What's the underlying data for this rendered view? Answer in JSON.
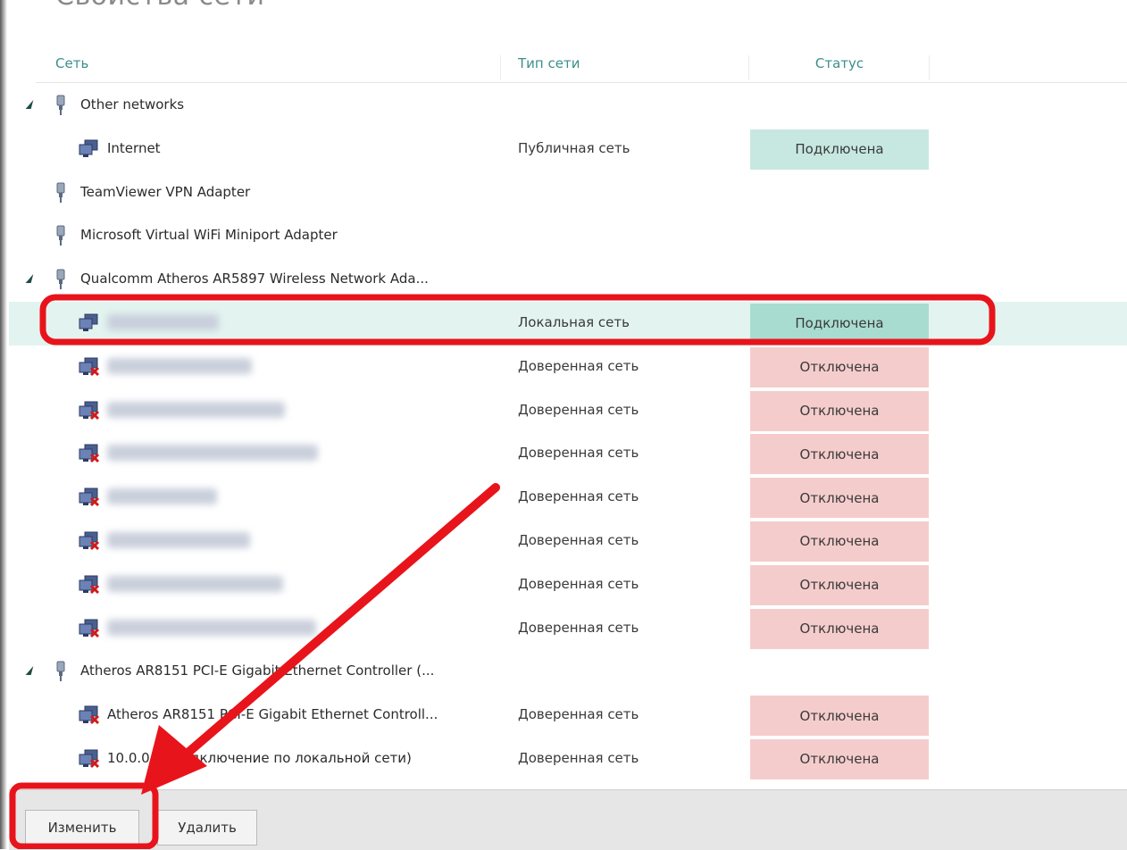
{
  "window": {
    "title": "Свойства сети"
  },
  "columns": {
    "network": "Сеть",
    "type": "Тип сети",
    "status": "Статус"
  },
  "rows": [
    {
      "kind": "adapter",
      "label": "Other networks",
      "expanded": true
    },
    {
      "kind": "network",
      "label": "Internet",
      "type": "Публичная сеть",
      "status": "Подключена"
    },
    {
      "kind": "adapter",
      "label": "TeamViewer VPN Adapter",
      "expanded": false
    },
    {
      "kind": "adapter",
      "label": "Microsoft Virtual WiFi Miniport Adapter",
      "expanded": false
    },
    {
      "kind": "adapter",
      "label": "Qualcomm Atheros AR5897 Wireless Network Ada...",
      "expanded": true
    },
    {
      "kind": "network",
      "label": "",
      "type": "Локальная сеть",
      "status": "Подключена",
      "selected": true
    },
    {
      "kind": "network-off",
      "label": "",
      "type": "Доверенная сеть",
      "status": "Отключена"
    },
    {
      "kind": "network-off",
      "label": "",
      "type": "Доверенная сеть",
      "status": "Отключена"
    },
    {
      "kind": "network-off",
      "label": "",
      "type": "Доверенная сеть",
      "status": "Отключена"
    },
    {
      "kind": "network-off",
      "label": "",
      "type": "Доверенная сеть",
      "status": "Отключена"
    },
    {
      "kind": "network-off",
      "label": "",
      "type": "Доверенная сеть",
      "status": "Отключена"
    },
    {
      "kind": "network-off",
      "label": "",
      "type": "Доверенная сеть",
      "status": "Отключена"
    },
    {
      "kind": "network-off",
      "label": "",
      "type": "Доверенная сеть",
      "status": "Отключена"
    },
    {
      "kind": "adapter",
      "label": "Atheros AR8151 PCI-E Gigabit Ethernet Controller (...",
      "expanded": true
    },
    {
      "kind": "network-off",
      "label": "Atheros AR8151 PCI-E Gigabit Ethernet Controll...",
      "type": "Доверенная сеть",
      "status": "Отключена"
    },
    {
      "kind": "network-off",
      "label": "10.0.0.2 (Подключение по локальной сети)",
      "type": "Доверенная сеть",
      "status": "Отключена"
    }
  ],
  "buttons": {
    "edit": "Изменить",
    "delete": "Удалить"
  },
  "colors": {
    "header_text": "#3a8f8a",
    "connected": "#c6e8e0",
    "disconnected": "#f5cccc",
    "selected_row": "#e3f4f0",
    "annotation": "#e8141b"
  },
  "icons": {
    "adapter": "network-adapter-icon",
    "network": "network-connection-icon",
    "network_off": "network-disconnected-icon",
    "expander": "expand-triangle-icon"
  }
}
